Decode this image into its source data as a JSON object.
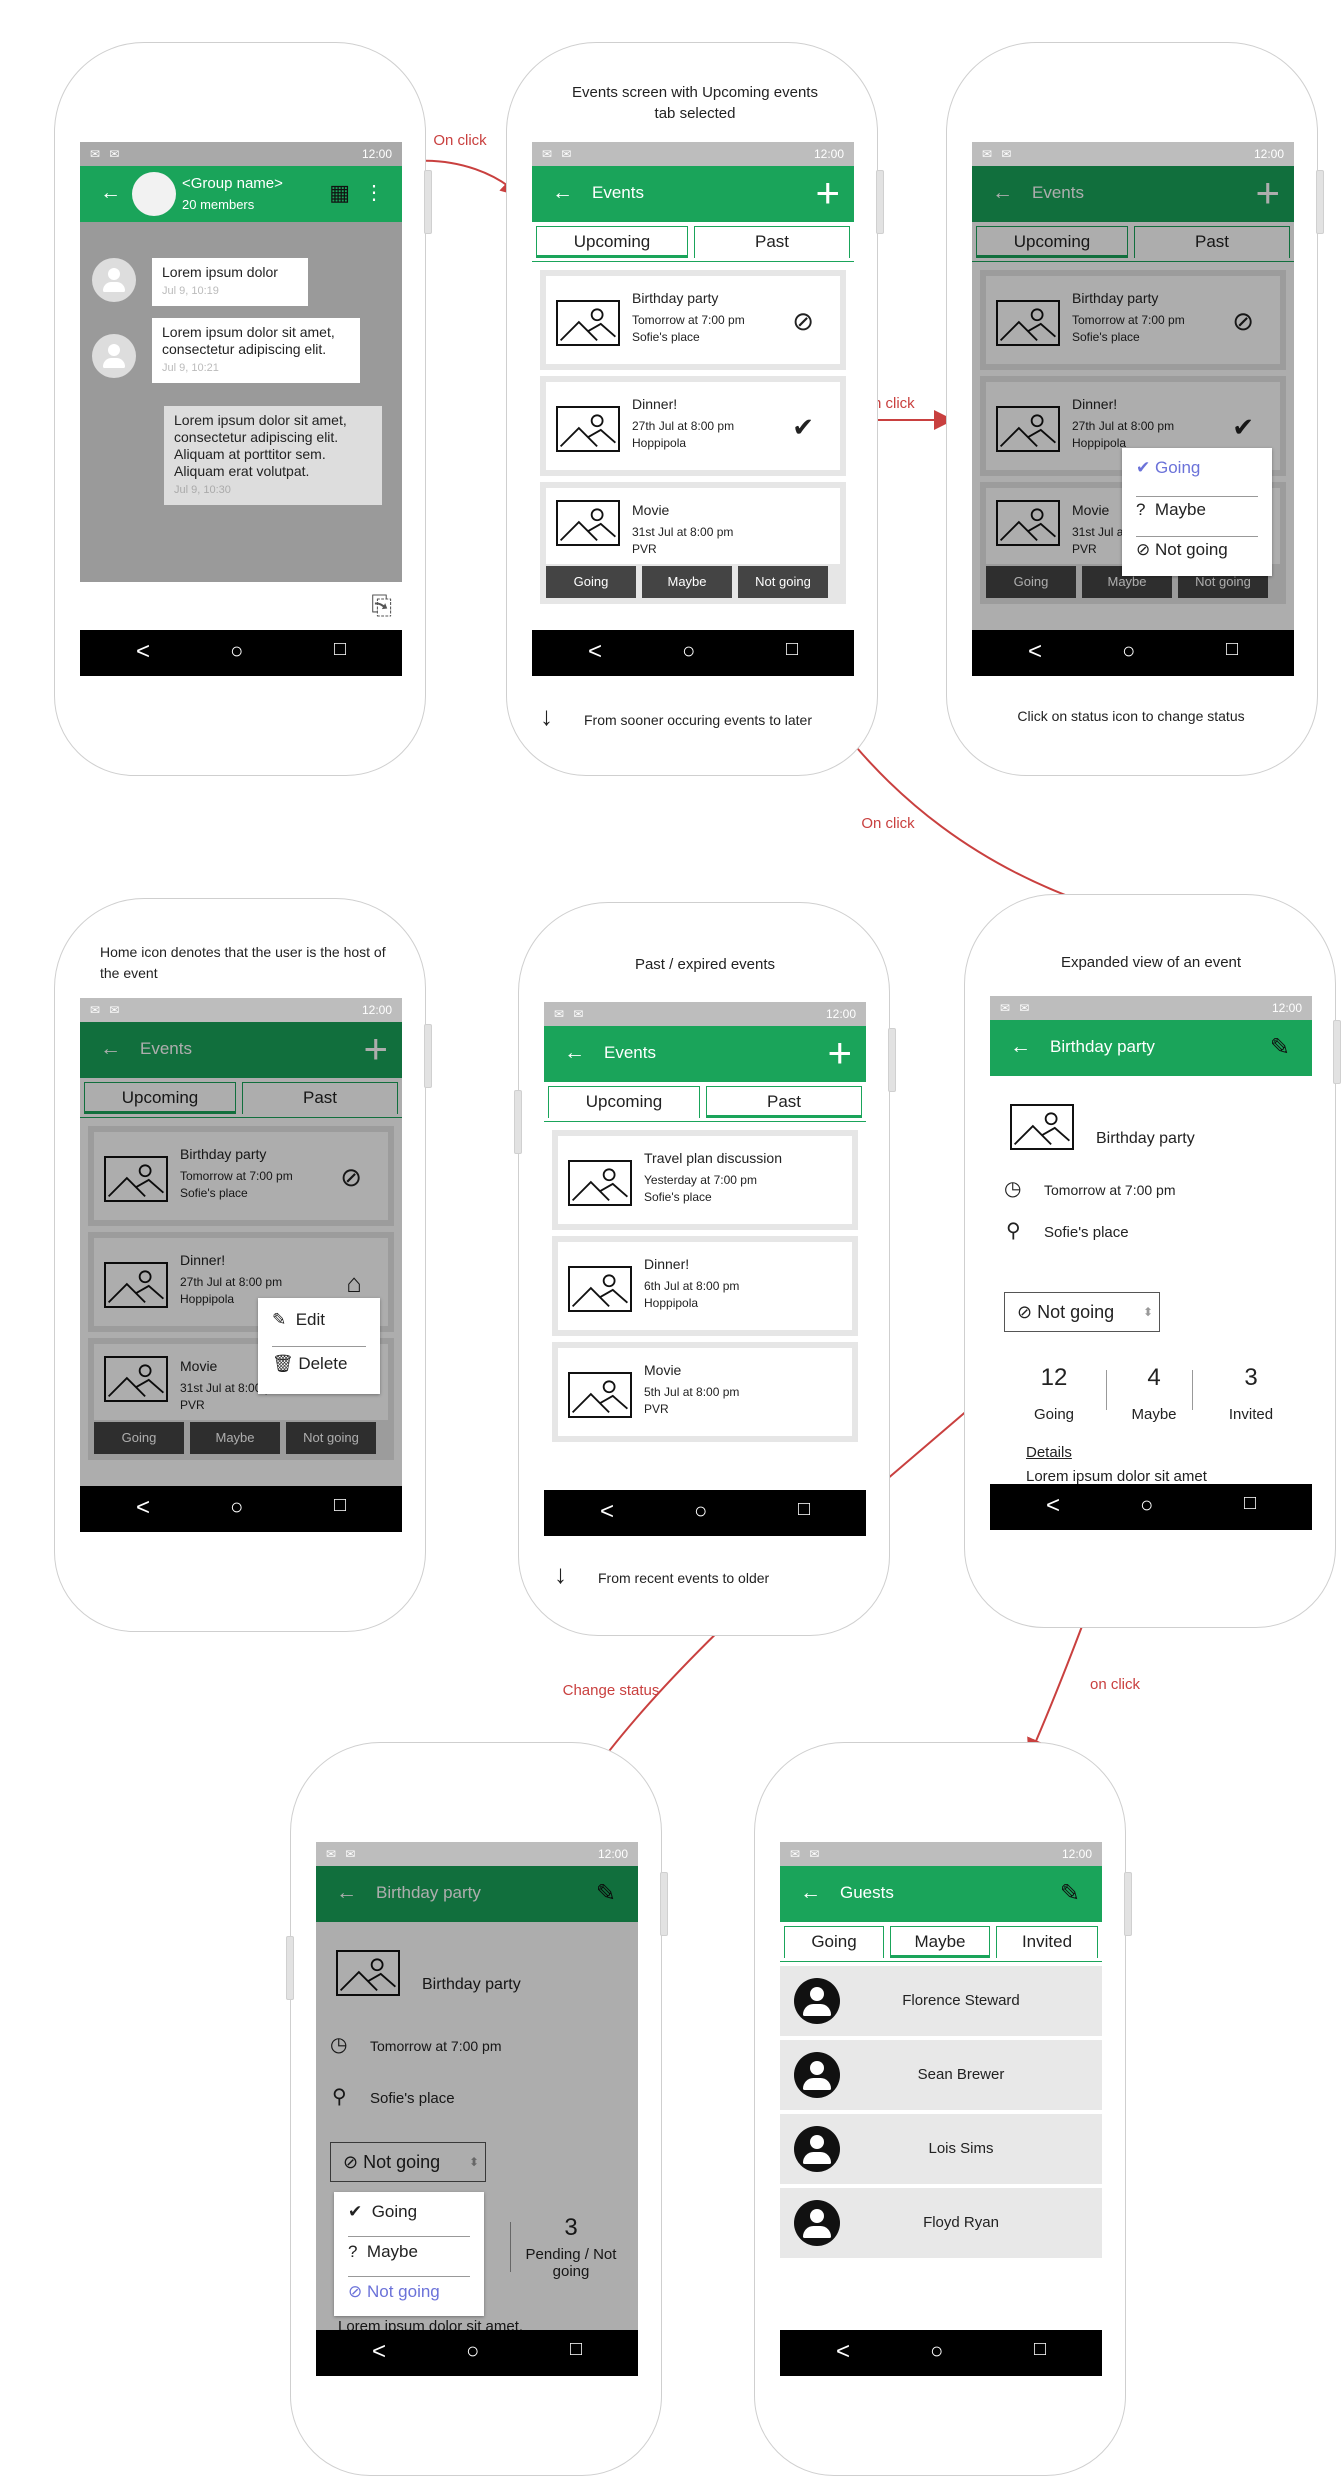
{
  "annotations": {
    "events_title": "Events screen with Upcoming events tab selected",
    "sooner_to_later": "From sooner occuring events to later",
    "click_status": "Click on status icon to change status",
    "home_icon": "Home icon denotes that the user is the host of the event",
    "past_expired": "Past / expired events",
    "expanded_view": "Expanded view of an event",
    "recent_to_older": "From recent events to older",
    "on_click_1": "On click",
    "on_click_2": "On click",
    "on_click_3": "On click",
    "change_status": "Change status",
    "on_click_lower": "on click"
  },
  "status_bar": {
    "time": "12:00",
    "left_icons": "✉ ✉"
  },
  "chat": {
    "group_name": "<Group name>",
    "members": "20 members",
    "messages": [
      {
        "text": "Lorem ipsum dolor",
        "time": "Jul 9, 10:19"
      },
      {
        "text": "Lorem ipsum dolor sit amet, consectetur adipiscing elit.",
        "time": "Jul 9, 10:21"
      },
      {
        "text": "Lorem ipsum dolor sit amet, consectetur adipiscing elit. Aliquam at porttitor sem. Aliquam erat volutpat.",
        "time": "Jul 9, 10:30"
      }
    ]
  },
  "events": {
    "title": "Events",
    "tab_upcoming": "Upcoming",
    "tab_past": "Past",
    "upcoming": [
      {
        "title": "Birthday party",
        "when": "Tomorrow at 7:00 pm",
        "where": "Sofie's place"
      },
      {
        "title": "Dinner!",
        "when": "27th Jul at 8:00 pm",
        "where": "Hoppipola"
      },
      {
        "title": "Movie",
        "when": "31st Jul at 8:00 pm",
        "where": "PVR"
      }
    ],
    "action_going": "Going",
    "action_maybe": "Maybe",
    "action_not_going": "Not going",
    "past": [
      {
        "title": "Travel plan discussion",
        "when": "Yesterday at 7:00 pm",
        "where": "Sofie's place"
      },
      {
        "title": "Dinner!",
        "when": "6th Jul at 8:00 pm",
        "where": "Hoppipola"
      },
      {
        "title": "Movie",
        "when": "5th Jul at 8:00 pm",
        "where": "PVR"
      }
    ],
    "status_menu": {
      "going": "Going",
      "maybe": "Maybe",
      "not_going": "Not going"
    },
    "host_menu": {
      "edit": "Edit",
      "delete": "Delete"
    }
  },
  "event_detail": {
    "title": "Birthday party",
    "name": "Birthday party",
    "when": "Tomorrow at 7:00 pm",
    "where": "Sofie's place",
    "status": "Not going",
    "going_count": "12",
    "going_label": "Going",
    "maybe_count": "4",
    "maybe_label": "Maybe",
    "invited_count": "3",
    "invited_label": "Invited",
    "details_label": "Details",
    "details_text": "Lorem ipsum dolor sit amet",
    "pending_count": "3",
    "pending_label": "Pending / Not going",
    "partial_maybe": "be",
    "details_text2": "Lorem ipsum dolor sit amet."
  },
  "guests": {
    "title": "Guests",
    "tab_going": "Going",
    "tab_maybe": "Maybe",
    "tab_invited": "Invited",
    "people": [
      "Florence Steward",
      "Sean Brewer",
      "Lois Sims",
      "Floyd Ryan"
    ]
  },
  "colors": {
    "primary": "#1aa45a",
    "accent_red": "#c9403f",
    "selected_blue": "#6b72d9"
  }
}
